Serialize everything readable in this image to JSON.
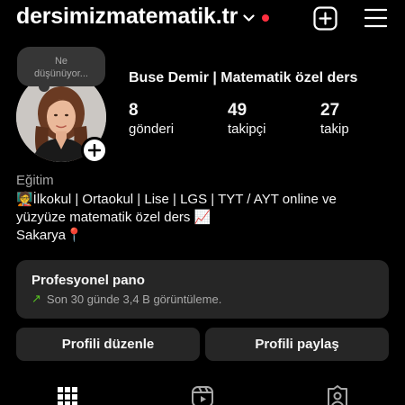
{
  "header": {
    "username": "dersimizmatematik.tr"
  },
  "profile": {
    "note": "Ne\ndüşünüyor...",
    "display_name": "Buse Demir | Matematik özel ders",
    "stats": [
      {
        "value": "8",
        "label": "gönderi"
      },
      {
        "value": "49",
        "label": "takipçi"
      },
      {
        "value": "27",
        "label": "takip"
      }
    ],
    "category": "Eğitim",
    "bio_line1": "🧑‍🏫İlkokul | Ortaokul | Lise | LGS | TYT / AYT online ve",
    "bio_line2": "yüzyüze matematik özel ders 📈",
    "bio_line3": "Sakarya📍"
  },
  "dashboard": {
    "title": "Profesyonel pano",
    "subtitle": "Son 30 günde 3,4 B görüntüleme."
  },
  "actions": {
    "edit_label": "Profili düzenle",
    "share_label": "Profili paylaş"
  },
  "colors": {
    "background": "#000000",
    "surface": "#262626",
    "notification_dot": "#ff3040",
    "trend_green": "#58c322"
  }
}
